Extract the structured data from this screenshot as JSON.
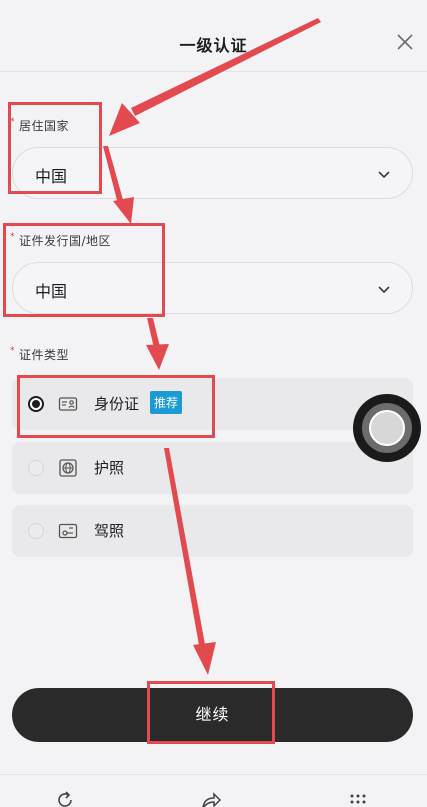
{
  "header": {
    "title": "一级认证",
    "close_icon": "close-icon"
  },
  "residence": {
    "label": "居住国家",
    "required_mark": "*",
    "value": "中国",
    "icon": "chevron-down-icon"
  },
  "issuing": {
    "label": "证件发行国/地区",
    "required_mark": "*",
    "value": "中国",
    "icon": "chevron-down-icon"
  },
  "id_type": {
    "label": "证件类型",
    "required_mark": "*",
    "options": [
      {
        "label": "身份证",
        "badge": "推荐",
        "selected": true,
        "icon": "id-card-icon"
      },
      {
        "label": "护照",
        "selected": false,
        "icon": "passport-globe-icon"
      },
      {
        "label": "驾照",
        "selected": false,
        "icon": "driver-license-icon"
      }
    ]
  },
  "continue_label": "继续",
  "bottom_nav": {
    "icons": [
      "refresh-icon",
      "share-icon",
      "more-icon"
    ]
  },
  "colors": {
    "annotation": "#e34a4f",
    "badge": "#1b9bd1",
    "primary_button": "#2a2a2a",
    "background": "#f3f2f4"
  }
}
